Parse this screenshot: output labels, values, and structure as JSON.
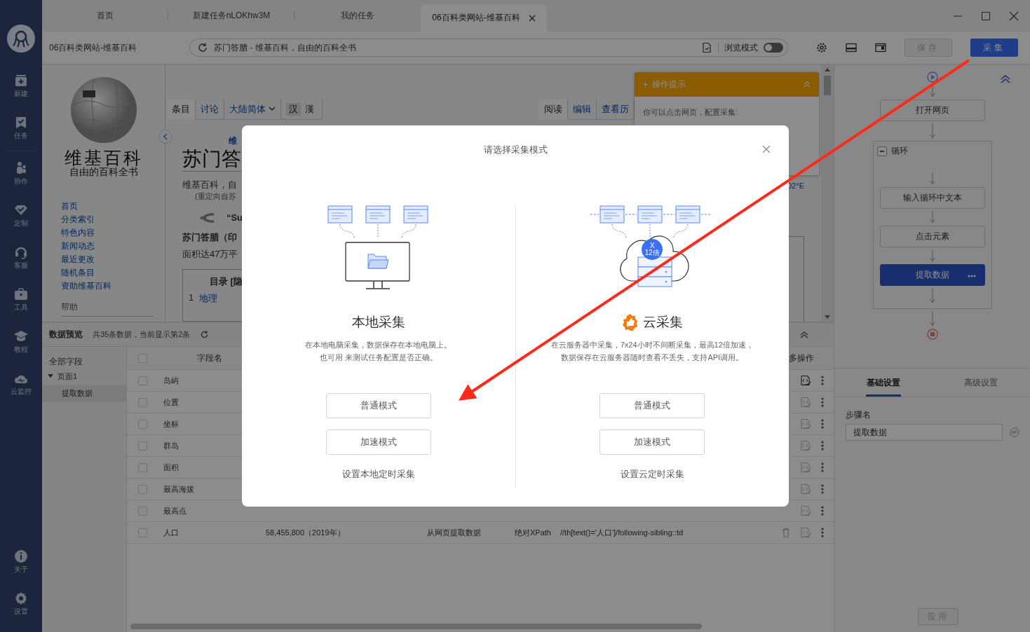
{
  "tabs": [
    {
      "label": "首页",
      "selected": false,
      "closable": false
    },
    {
      "label": "新建任务nLOKhw3M",
      "selected": false,
      "closable": false
    },
    {
      "label": "我的任务",
      "selected": false,
      "closable": false
    },
    {
      "label": "06百科类网站-维基百科",
      "selected": true,
      "closable": true
    }
  ],
  "toolbar": {
    "task_title": "06百科类网站-维基百科",
    "address": "苏门答腊 - 维基百科，自由的百科全书",
    "browse_mode": {
      "label": "浏览模式",
      "on": false
    },
    "save_button": {
      "label": "保存",
      "disabled": true
    },
    "collect_button": {
      "label": "采集",
      "disabled": false
    }
  },
  "rail": {
    "items": [
      {
        "label": "新建",
        "kind": "new"
      },
      {
        "label": "任务",
        "kind": "task"
      },
      {
        "label": "协作",
        "kind": "collab"
      },
      {
        "label": "定制",
        "kind": "custom"
      },
      {
        "label": "客服",
        "kind": "service"
      },
      {
        "label": "工具",
        "kind": "tools"
      },
      {
        "label": "教程",
        "kind": "tutorial"
      },
      {
        "label": "云监控",
        "kind": "monitor"
      }
    ],
    "bottom_items": [
      {
        "label": "关于",
        "kind": "about"
      },
      {
        "label": "设置",
        "kind": "settings"
      }
    ]
  },
  "wiki": {
    "logo_title": "维基百科",
    "logo_subtitle": "自由的百科全书",
    "nav": [
      "首页",
      "分类索引",
      "特色内容",
      "新闻动态",
      "最近更改",
      "随机条目",
      "资助维基百科"
    ],
    "help_heading": "帮助",
    "left_tabs": [
      {
        "label": "条目",
        "selected": true,
        "kind": "tab"
      },
      {
        "label": "讨论",
        "selected": false,
        "kind": "tab"
      },
      {
        "label": "大陆简体",
        "selected": false,
        "kind": "dropdown"
      }
    ],
    "variants": [
      {
        "label": "汉",
        "selected": true
      },
      {
        "label": "漢",
        "selected": false
      }
    ],
    "right_tabs": [
      {
        "label": "阅读",
        "selected": true
      },
      {
        "label": "编辑",
        "selected": false
      },
      {
        "label": "查看历",
        "selected": false
      }
    ],
    "article": {
      "site_note": "维",
      "heading": "苏门答",
      "lead": "维基百科，自",
      "redirect": "(重定向自苏",
      "quote": "“Su",
      "bold_lead": "苏门答腊（印",
      "area": "面积达47万平",
      "toc_title": "目录 [隐",
      "toc_items": [
        {
          "number": "1",
          "label": "地理"
        }
      ]
    },
    "coordinate": "02°E",
    "tip": {
      "symbol": "+",
      "title": "操作提示",
      "text": "你可以点击网页，配置采集:"
    }
  },
  "preview": {
    "title": "数据预览",
    "summary": "共35条数据，当前显示第2条",
    "tree": {
      "root": "全部字段",
      "pages": [
        {
          "label": "页面1",
          "expanded": true,
          "children": [
            {
              "label": "提取数据",
              "selected": true
            }
          ]
        }
      ]
    },
    "all_checked": false,
    "name_header": "字段名",
    "ops_header": "多操作",
    "rows": [
      {
        "name": "岛屿",
        "checked": false,
        "active": true
      },
      {
        "name": "位置",
        "checked": false,
        "active": false
      },
      {
        "name": "坐标",
        "checked": false,
        "active": false
      },
      {
        "name": "群岛",
        "checked": false,
        "active": false
      },
      {
        "name": "面积",
        "checked": false,
        "active": false
      },
      {
        "name": "最高海拔",
        "checked": false,
        "active": false
      },
      {
        "name": "最高点",
        "checked": false,
        "active": false
      },
      {
        "name": "人口",
        "checked": false,
        "active": false,
        "value": "58,455,800（2019年）",
        "source": "从网页提取数据",
        "xpath_type": "绝对XPath",
        "xpath": "//th[text()='人口']/following-sibling::td"
      }
    ]
  },
  "flow": {
    "steps": [
      {
        "label": "打开网页",
        "kind": "step",
        "selected": false
      },
      {
        "label": "循环",
        "kind": "loop",
        "expanded": true,
        "children": [
          {
            "label": "输入循环中文本",
            "kind": "step",
            "selected": false
          },
          {
            "label": "点击元素",
            "kind": "step",
            "selected": false
          },
          {
            "label": "提取数据",
            "kind": "step",
            "selected": true
          }
        ]
      }
    ]
  },
  "settings": {
    "tabs": [
      {
        "label": "基础设置",
        "selected": true
      },
      {
        "label": "高级设置",
        "selected": false
      }
    ],
    "step_name_label": "步骤名",
    "step_name": "提取数据",
    "apply_button": {
      "label": "应用",
      "disabled": true
    }
  },
  "modal": {
    "title": "请选择采集模式",
    "options": [
      {
        "kind": "local",
        "title": "本地采集",
        "recommended": false,
        "description_lines": [
          "在本地电脑采集，数据保存在本地电脑上。",
          "也可用 来测试任务配置是否正确。"
        ],
        "buttons": [
          "普通模式",
          "加速模式"
        ],
        "schedule_link": "设置本地定时采集"
      },
      {
        "kind": "cloud",
        "title": "云采集",
        "recommended": true,
        "badge": "X\n12倍",
        "description_lines": [
          "在云服务器中采集，7x24小时不间断采集，最高12倍加速，",
          "数据保存在云服务器随时查看不丢失，支持API调用。"
        ],
        "buttons": [
          "普通模式",
          "加速模式"
        ],
        "schedule_link": "设置云定时采集"
      }
    ]
  }
}
